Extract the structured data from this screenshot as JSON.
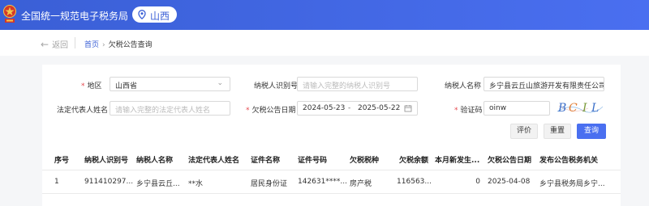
{
  "header": {
    "title": "全国统一规范电子税务局",
    "region": "山西",
    "emblem_color": "#d4382a",
    "brand_color": "#3a5fd6"
  },
  "nav": {
    "back_label": "返回",
    "breadcrumb": {
      "home": "首页",
      "separator": "›",
      "current": "欠税公告查询"
    }
  },
  "form": {
    "region": {
      "label": "地区",
      "value": "山西省"
    },
    "taxpayer_id": {
      "label": "纳税人识别号",
      "placeholder": "请输入完整的纳税人识别号"
    },
    "taxpayer_name": {
      "label": "纳税人名称",
      "value": "乡宁县云丘山旅游开发有限责任公司"
    },
    "legal_rep": {
      "label": "法定代表人姓名",
      "placeholder": "请输入完整的法定代表人姓名"
    },
    "announce_date": {
      "label": "欠税公告日期",
      "start": "2024-05-23",
      "separator": "-",
      "end": "2025-05-22"
    },
    "captcha": {
      "label": "验证码",
      "value": "oinw",
      "image_chars": [
        "B",
        "C",
        "I",
        "L"
      ]
    }
  },
  "buttons": {
    "evaluate": "评价",
    "reset": "重置",
    "query": "查询"
  },
  "table": {
    "columns": [
      "序号",
      "纳税人识别号",
      "纳税人名称",
      "法定代表人姓名",
      "证件名称",
      "证件号码",
      "欠税税种",
      "欠税余额",
      "本月新发生...",
      "欠税公告日期",
      "发布公告税务机关"
    ],
    "rows": [
      [
        "1",
        "911410297...",
        "乡宁县云丘...",
        "**水",
        "居民身份证",
        "142631****...",
        "房产税",
        "116563...",
        "0",
        "2025-04-08",
        "乡宁县税务局乡宁..."
      ]
    ]
  }
}
